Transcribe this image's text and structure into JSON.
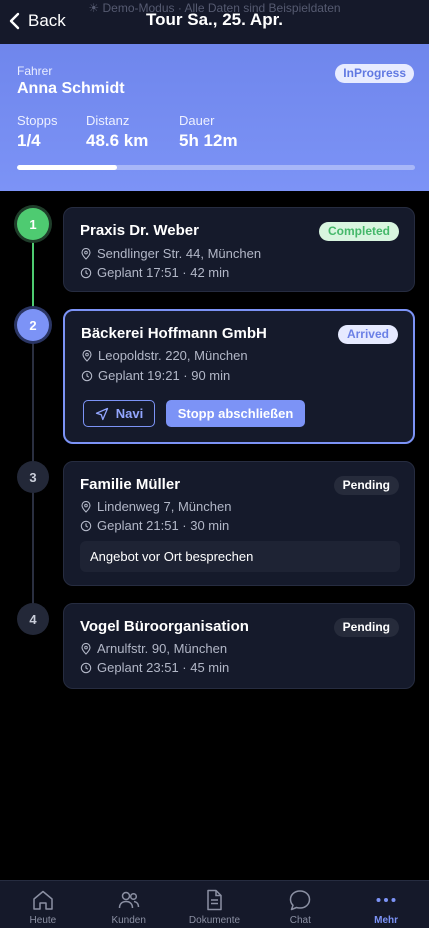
{
  "demo_banner": "☀ Demo-Modus · Alle Daten sind Beispieldaten",
  "header": {
    "back_label": "Back",
    "title": "Tour Sa., 25. Apr."
  },
  "summary": {
    "driver_label": "Fahrer",
    "driver_name": "Anna Schmidt",
    "status": "InProgress",
    "stats": [
      {
        "label": "Stopps",
        "value": "1/4"
      },
      {
        "label": "Distanz",
        "value": "48.6 km"
      },
      {
        "label": "Dauer",
        "value": "5h 12m"
      }
    ],
    "progress": 0.25
  },
  "stops": [
    {
      "number": "1",
      "name": "Praxis Dr. Weber",
      "status": "Completed",
      "address": "Sendlinger Str. 44, München",
      "planned": "Geplant 17:51 · 42 min"
    },
    {
      "number": "2",
      "name": "Bäckerei Hoffmann GmbH",
      "status": "Arrived",
      "address": "Leopoldstr. 220, München",
      "planned": "Geplant 19:21 · 90 min",
      "navi_label": "Navi",
      "finish_label": "Stopp abschließen"
    },
    {
      "number": "3",
      "name": "Familie Müller",
      "status": "Pending",
      "address": "Lindenweg 7, München",
      "planned": "Geplant 21:51 · 30 min",
      "note": "Angebot vor Ort besprechen"
    },
    {
      "number": "4",
      "name": "Vogel Büroorganisation",
      "status": "Pending",
      "address": "Arnulfstr. 90, München",
      "planned": "Geplant 23:51 · 45 min"
    }
  ],
  "colors": {
    "accent": "#7c93f6",
    "completed": "#4ecb71",
    "card_bg": "#151a2b",
    "page_bg": "#000000"
  },
  "tabbar": [
    {
      "label": "Heute",
      "icon": "home-icon"
    },
    {
      "label": "Kunden",
      "icon": "users-icon"
    },
    {
      "label": "Dokumente",
      "icon": "document-icon"
    },
    {
      "label": "Chat",
      "icon": "chat-icon"
    },
    {
      "label": "Mehr",
      "icon": "more-icon",
      "active": true
    }
  ]
}
